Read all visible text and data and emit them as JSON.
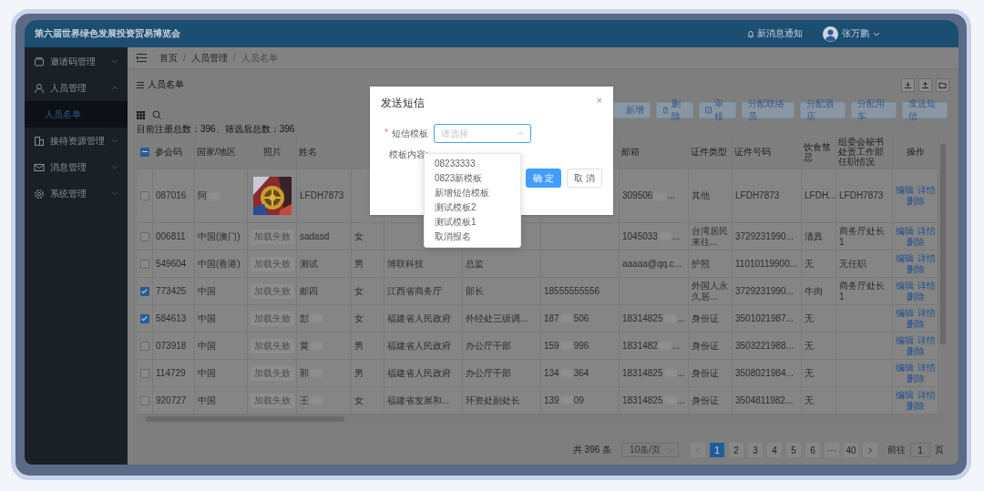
{
  "header": {
    "title": "第六届世界绿色发展投资贸易博览会",
    "notice": "新消息通知",
    "user": "张万鹏"
  },
  "sidebar": {
    "items": [
      {
        "label": "邀请码管理",
        "expanded": false
      },
      {
        "label": "人员管理",
        "expanded": true,
        "children": [
          {
            "label": "人员名单",
            "selected": true
          }
        ]
      },
      {
        "label": "接待资源管理",
        "expanded": false
      },
      {
        "label": "消息管理",
        "expanded": false
      },
      {
        "label": "系统管理",
        "expanded": false
      }
    ]
  },
  "breadcrumb": [
    "首页",
    "/",
    "人员管理",
    "/",
    "人员名单"
  ],
  "page_title": "人员名单",
  "toolbar": {
    "buttons": [
      "新增",
      "删除",
      "审核",
      "分配联络员",
      "分配酒店",
      "分配用车",
      "发送短信"
    ]
  },
  "summary": "目前注册总数：396、筛选后总数：396",
  "table": {
    "header_checkbox": {
      "indeterminate": true
    },
    "columns": [
      "参会码",
      "国家/地区",
      "照片",
      "姓名",
      null,
      null,
      null,
      null,
      "邮箱",
      "证件类型",
      "证件号码",
      "饮食禁忌",
      "组委会秘书处责工作部任职情况",
      "操作"
    ],
    "rows": [
      {
        "selected": false,
        "cells": [
          "087016",
          [
            "阿"
          ],
          {
            "kind": "picture"
          },
          "LFDH7873",
          null,
          null,
          null,
          null,
          [
            "309506",
            "..."
          ],
          "其他",
          "LFDH7873",
          "LFDH...",
          "LFDH7873"
        ],
        "actions": [
          "编辑",
          "详情",
          "删除"
        ]
      },
      {
        "selected": false,
        "cells": [
          "006811",
          "中国(澳门)",
          {
            "kind": "failed",
            "text": "加载失败"
          },
          "sadasd",
          "女",
          null,
          null,
          null,
          [
            "1045033",
            "..."
          ],
          "台湾居民来往...",
          "3729231990...",
          "清真",
          "商务厅处长1"
        ],
        "actions": [
          "编辑",
          "详情",
          "删除"
        ]
      },
      {
        "selected": false,
        "cells": [
          "549604",
          "中国(香港)",
          {
            "kind": "failed",
            "text": "加载失败"
          },
          "测试",
          "男",
          "博联科技",
          "总监",
          null,
          "aaaaa@qq.c...",
          "护照",
          "11010119900...",
          "无",
          "无任职"
        ],
        "actions": [
          "编辑",
          "详情",
          "删除"
        ]
      },
      {
        "selected": true,
        "cells": [
          "773425",
          "中国",
          {
            "kind": "failed",
            "text": "加载失败"
          },
          "邮四",
          "女",
          "江西省商务厅",
          "部长",
          "18555555556",
          null,
          "外国人永久居...",
          "3729231990...",
          "牛肉",
          "商务厅处长1"
        ],
        "actions": [
          "编辑",
          "详情",
          "删除"
        ]
      },
      {
        "selected": true,
        "cells": [
          "584613",
          "中国",
          {
            "kind": "failed",
            "text": "加载失败"
          },
          [
            "彭"
          ],
          "女",
          "福建省人民政府",
          "外经处三级调...",
          [
            "187",
            "506"
          ],
          [
            "18314825",
            "..."
          ],
          "身份证",
          "3501021987...",
          "无",
          null
        ],
        "actions": [
          "编辑",
          "详情",
          "删除"
        ]
      },
      {
        "selected": false,
        "cells": [
          "073918",
          "中国",
          {
            "kind": "failed",
            "text": "加载失败"
          },
          [
            "黄"
          ],
          "男",
          "福建省人民政府",
          "办公厅干部",
          [
            "159",
            "996"
          ],
          [
            "1831482",
            "..."
          ],
          "身份证",
          "3503221988...",
          "无",
          null
        ],
        "actions": [
          "编辑",
          "详情",
          "删除"
        ]
      },
      {
        "selected": false,
        "cells": [
          "114729",
          "中国",
          {
            "kind": "failed",
            "text": "加载失败"
          },
          [
            "郭"
          ],
          "男",
          "福建省人民政府",
          "办公厅干部",
          [
            "134",
            "364"
          ],
          [
            "18314825",
            "..."
          ],
          "身份证",
          "3508021984...",
          "无",
          null
        ],
        "actions": [
          "编辑",
          "详情",
          "删除"
        ]
      },
      {
        "selected": false,
        "cells": [
          "920727",
          "中国",
          {
            "kind": "failed",
            "text": "加载失败"
          },
          [
            "王"
          ],
          "女",
          "福建省发展和...",
          "环资处副处长",
          [
            "139",
            "09"
          ],
          [
            "18314825",
            "..."
          ],
          "身份证",
          "3504811982...",
          "无",
          null
        ],
        "actions": [
          "编辑",
          "详情",
          "删除"
        ]
      }
    ]
  },
  "pagination": {
    "total": "共 396 条",
    "page_size": "10条/页",
    "pages": [
      {
        "label": "1",
        "selected": true
      },
      {
        "label": "2",
        "selected": false
      },
      {
        "label": "3",
        "selected": false
      },
      {
        "label": "4",
        "selected": false
      },
      {
        "label": "5",
        "selected": false
      },
      {
        "label": "6",
        "selected": false
      },
      {
        "label": "···",
        "selected": false
      },
      {
        "label": "40",
        "selected": false
      }
    ],
    "goto_label": "前往",
    "goto_value": "1",
    "goto_unit": "页"
  },
  "dialog": {
    "title": "发送短信",
    "close": "×",
    "required_mark": "*",
    "template_label": "短信模板",
    "template_placeholder": "请选择",
    "dropdown_open": true,
    "content_label": "模板内容:",
    "confirm": "确 定",
    "cancel": "取 消",
    "options": [
      "08233333",
      "0823新模板",
      "新增短信模板",
      "测试模板2",
      "测试模板1",
      "取消报名"
    ]
  }
}
